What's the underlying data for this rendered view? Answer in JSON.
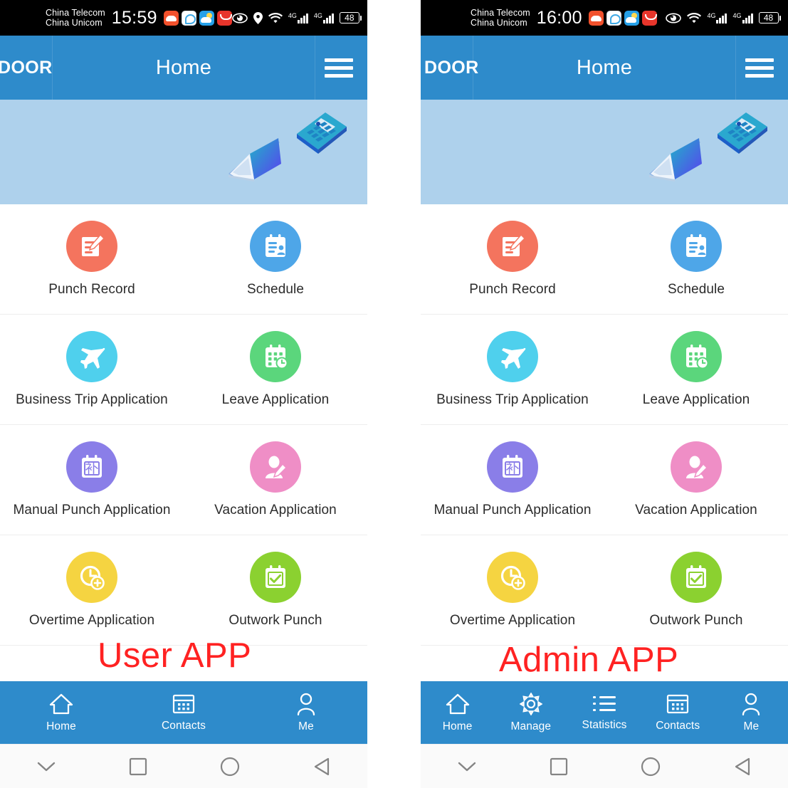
{
  "annotations": {
    "left": "User APP",
    "right": "Admin APP",
    "color": "#ff2222"
  },
  "theme": {
    "appbar_blue": "#2e8bcb",
    "banner_blue": "#aed1ec",
    "statusbar_black": "#000000",
    "divider_gray": "#ededed",
    "label_text": "#2b2b2b"
  },
  "phones": [
    {
      "id": "user-app",
      "status_bar": {
        "carrier_line1": "China Telecom",
        "carrier_line2": "China Unicom",
        "time": "15:59",
        "app_icons": [
          "cloud-app-icon",
          "qq-app-icon",
          "weather-app-icon",
          "taobao-app-icon"
        ],
        "system_icons": [
          "eye-icon",
          "location-pin-icon",
          "wifi-icon",
          "signal-4g-icon",
          "signal-4g-icon"
        ],
        "network_label": "4G",
        "battery_level": "48"
      },
      "appbar": {
        "brand": "DOOR",
        "title": "Home",
        "menu_icon": "hamburger-menu-icon"
      },
      "banner": {
        "illustrations": [
          "isometric-laptop-illustration",
          "isometric-calculator-illustration"
        ]
      },
      "grid": [
        {
          "label": "Punch Record",
          "icon": "document-pencil-icon",
          "color": "#f4745e"
        },
        {
          "label": "Schedule",
          "icon": "id-card-calendar-icon",
          "color": "#4ea6e8"
        },
        {
          "label": "Business Trip Application",
          "icon": "airplane-icon",
          "color": "#4fd0ed"
        },
        {
          "label": "Leave Application",
          "icon": "calendar-clock-icon",
          "color": "#5bd67c"
        },
        {
          "label": "Manual Punch Application",
          "icon": "calendar-bu-icon",
          "color": "#8a7ee8",
          "glyph": "补"
        },
        {
          "label": "Vacation Application",
          "icon": "person-pencil-icon",
          "color": "#ef8ec6"
        },
        {
          "label": "Overtime Application",
          "icon": "clock-plus-icon",
          "color": "#f5d441"
        },
        {
          "label": "Outwork Punch",
          "icon": "calendar-check-icon",
          "color": "#8bd130"
        }
      ],
      "bottom_nav": [
        {
          "label": "Home",
          "icon": "home-icon",
          "active": true
        },
        {
          "label": "Contacts",
          "icon": "contacts-icon",
          "active": false
        },
        {
          "label": "Me",
          "icon": "person-icon",
          "active": false
        }
      ],
      "android_nav": [
        "chevron-down-icon",
        "recents-square-icon",
        "home-circle-icon",
        "back-triangle-icon"
      ]
    },
    {
      "id": "admin-app",
      "status_bar": {
        "carrier_line1": "China Telecom",
        "carrier_line2": "China Unicom",
        "time": "16:00",
        "app_icons": [
          "cloud-app-icon",
          "qq-app-icon",
          "weather-app-icon",
          "taobao-app-icon"
        ],
        "system_icons": [
          "eye-icon",
          "wifi-icon",
          "signal-4g-icon",
          "signal-4g-icon"
        ],
        "network_label": "4G",
        "battery_level": "48"
      },
      "appbar": {
        "brand": "DOOR",
        "title": "Home",
        "menu_icon": "hamburger-menu-icon"
      },
      "banner": {
        "illustrations": [
          "isometric-laptop-illustration",
          "isometric-calculator-illustration"
        ]
      },
      "grid": [
        {
          "label": "Punch Record",
          "icon": "document-pencil-icon",
          "color": "#f4745e"
        },
        {
          "label": "Schedule",
          "icon": "id-card-calendar-icon",
          "color": "#4ea6e8"
        },
        {
          "label": "Business Trip Application",
          "icon": "airplane-icon",
          "color": "#4fd0ed"
        },
        {
          "label": "Leave Application",
          "icon": "calendar-clock-icon",
          "color": "#5bd67c"
        },
        {
          "label": "Manual Punch Application",
          "icon": "calendar-bu-icon",
          "color": "#8a7ee8",
          "glyph": "补"
        },
        {
          "label": "Vacation Application",
          "icon": "person-pencil-icon",
          "color": "#ef8ec6"
        },
        {
          "label": "Overtime Application",
          "icon": "clock-plus-icon",
          "color": "#f5d441"
        },
        {
          "label": "Outwork Punch",
          "icon": "calendar-check-icon",
          "color": "#8bd130"
        }
      ],
      "bottom_nav": [
        {
          "label": "Home",
          "icon": "home-icon",
          "active": true
        },
        {
          "label": "Manage",
          "icon": "gear-icon",
          "active": false
        },
        {
          "label": "Statistics",
          "icon": "list-icon",
          "active": false
        },
        {
          "label": "Contacts",
          "icon": "contacts-icon",
          "active": false
        },
        {
          "label": "Me",
          "icon": "person-icon",
          "active": false
        }
      ],
      "android_nav": [
        "chevron-down-icon",
        "recents-square-icon",
        "home-circle-icon",
        "back-triangle-icon"
      ]
    }
  ]
}
